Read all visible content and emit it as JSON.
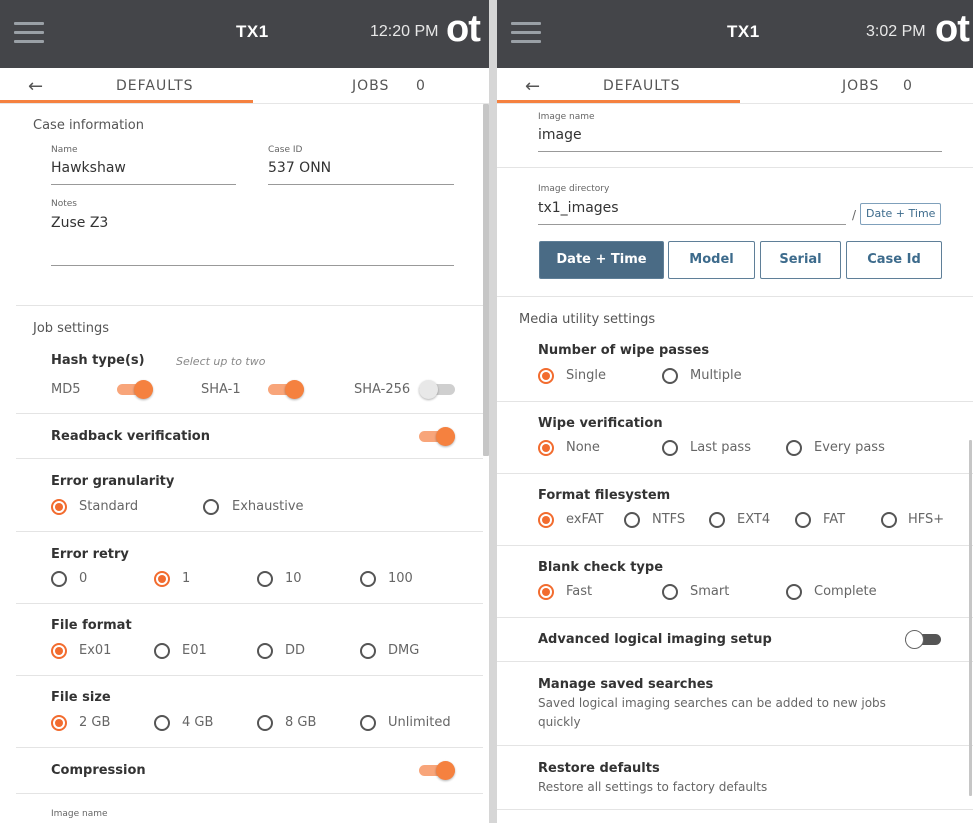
{
  "left": {
    "device": "TX1",
    "time": "12:20 PM",
    "logo": "ot",
    "tab_defaults": "DEFAULTS",
    "tab_jobs": "JOBS",
    "jobs_count": "0",
    "case_section": "Case information",
    "name_label": "Name",
    "name_value": "Hawkshaw",
    "caseid_label": "Case ID",
    "caseid_value": "537 ONN",
    "notes_label": "Notes",
    "notes_value": "Zuse Z3",
    "job_section": "Job settings",
    "hash_heading": "Hash type(s)",
    "hash_hint": "Select up to two",
    "hash_md5": "MD5",
    "hash_sha1": "SHA-1",
    "hash_sha256": "SHA-256",
    "readback": "Readback verification",
    "error_gran_heading": "Error granularity",
    "gran_standard": "Standard",
    "gran_exhaustive": "Exhaustive",
    "retry_heading": "Error retry",
    "retry_0": "0",
    "retry_1": "1",
    "retry_10": "10",
    "retry_100": "100",
    "format_heading": "File format",
    "fmt_ex01": "Ex01",
    "fmt_e01": "E01",
    "fmt_dd": "DD",
    "fmt_dmg": "DMG",
    "size_heading": "File size",
    "size_2": "2 GB",
    "size_4": "4 GB",
    "size_8": "8 GB",
    "size_unl": "Unlimited",
    "compression": "Compression",
    "image_name_label": "Image name"
  },
  "right": {
    "device": "TX1",
    "time": "3:02 PM",
    "logo": "ot",
    "tab_defaults": "DEFAULTS",
    "tab_jobs": "JOBS",
    "jobs_count": "0",
    "image_name_label": "Image name",
    "image_name_value": "image",
    "image_dir_label": "Image directory",
    "image_dir_value": "tx1_images",
    "slash": "/",
    "dir_chip": "Date + Time",
    "btn_datetime": "Date + Time",
    "btn_model": "Model",
    "btn_serial": "Serial",
    "btn_caseid": "Case Id",
    "media_section": "Media utility settings",
    "wipe_heading": "Number of wipe passes",
    "wipe_single": "Single",
    "wipe_multiple": "Multiple",
    "verif_heading": "Wipe verification",
    "verif_none": "None",
    "verif_last": "Last pass",
    "verif_every": "Every pass",
    "fs_heading": "Format filesystem",
    "fs_exfat": "exFAT",
    "fs_ntfs": "NTFS",
    "fs_ext4": "EXT4",
    "fs_fat": "FAT",
    "fs_hfs": "HFS+",
    "blank_heading": "Blank check type",
    "blank_fast": "Fast",
    "blank_smart": "Smart",
    "blank_complete": "Complete",
    "advanced": "Advanced logical imaging setup",
    "manage_heading": "Manage saved searches",
    "manage_desc": "Saved logical imaging searches can be added to new jobs quickly",
    "restore_heading": "Restore defaults",
    "restore_desc": "Restore all settings to factory defaults"
  },
  "colors": {
    "accent": "#f26c2f",
    "topbar": "#444549",
    "button_active": "#4a6b85"
  },
  "icons": [
    "hamburger-icon",
    "back-arrow-icon"
  ]
}
